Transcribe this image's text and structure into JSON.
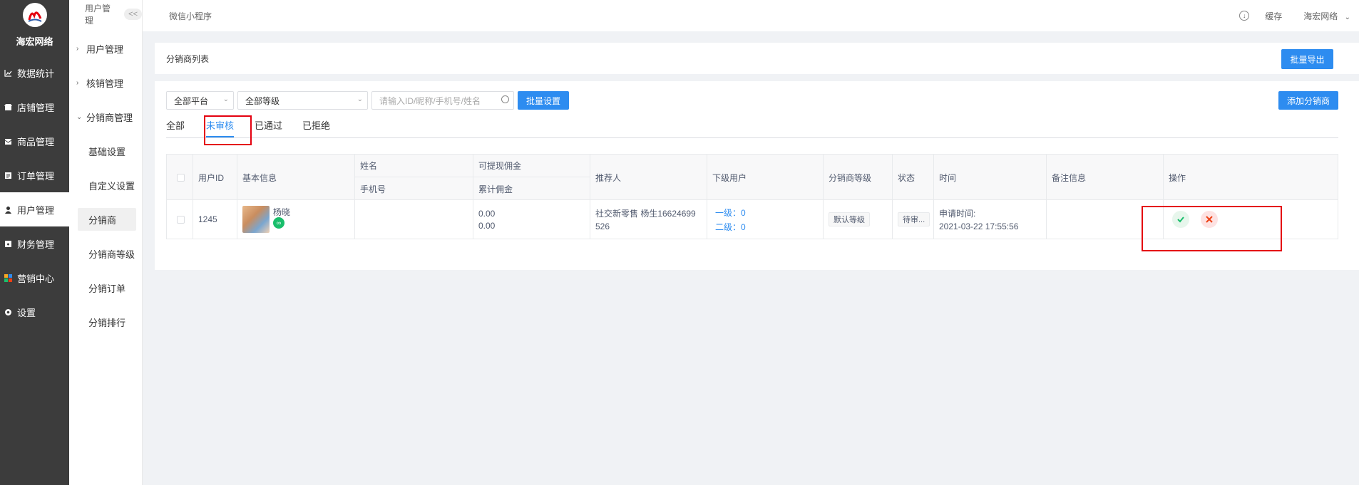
{
  "brand": {
    "name": "海宏网络"
  },
  "sidebar": {
    "items": [
      {
        "label": "数据统计",
        "icon": "chart-icon"
      },
      {
        "label": "店铺管理",
        "icon": "store-icon"
      },
      {
        "label": "商品管理",
        "icon": "goods-icon"
      },
      {
        "label": "订单管理",
        "icon": "order-icon"
      },
      {
        "label": "用户管理",
        "icon": "user-icon"
      },
      {
        "label": "财务管理",
        "icon": "finance-icon"
      },
      {
        "label": "营销中心",
        "icon": "marketing-icon"
      },
      {
        "label": "设置",
        "icon": "settings-icon"
      }
    ],
    "active_index": 4
  },
  "submenu": {
    "header": "用户管理",
    "collapse": "<<",
    "groups": [
      "用户管理",
      "核销管理",
      "分销商管理"
    ],
    "items": [
      "基础设置",
      "自定义设置",
      "分销商",
      "分销商等级",
      "分销订单",
      "分销排行"
    ],
    "active_item": "分销商"
  },
  "topbar": {
    "app_name": "微信小程序",
    "cache": "缓存",
    "account": "海宏网络"
  },
  "list_card": {
    "title": "分销商列表",
    "export_label": "批量导出"
  },
  "filters": {
    "platform": "全部平台",
    "level": "全部等级",
    "search_placeholder": "请输入ID/昵称/手机号/姓名",
    "batch_label": "批量设置",
    "add_label": "添加分销商"
  },
  "tabs": [
    "全部",
    "未审核",
    "已通过",
    "已拒绝"
  ],
  "active_tab": "未审核",
  "table": {
    "headers": {
      "user_id": "用户ID",
      "basic_info": "基本信息",
      "name": "姓名",
      "phone": "手机号",
      "withdrawable": "可提现佣金",
      "cumulative": "累计佣金",
      "referrer": "推荐人",
      "subordinates": "下级用户",
      "level": "分销商等级",
      "status": "状态",
      "time": "时间",
      "remark": "备注信息",
      "actions": "操作"
    },
    "rows": [
      {
        "user_id": "1245",
        "nickname": "杨晓",
        "withdrawable": "0.00",
        "cumulative": "0.00",
        "referrer_line1": "社交新零售 杨生16624699",
        "referrer_line2": "526",
        "level1": "一级：0",
        "level2": "二级：0",
        "level": "默认等级",
        "status": "待审...",
        "time_label": "申请时间:",
        "time_value": "2021-03-22 17:55:56"
      }
    ]
  }
}
